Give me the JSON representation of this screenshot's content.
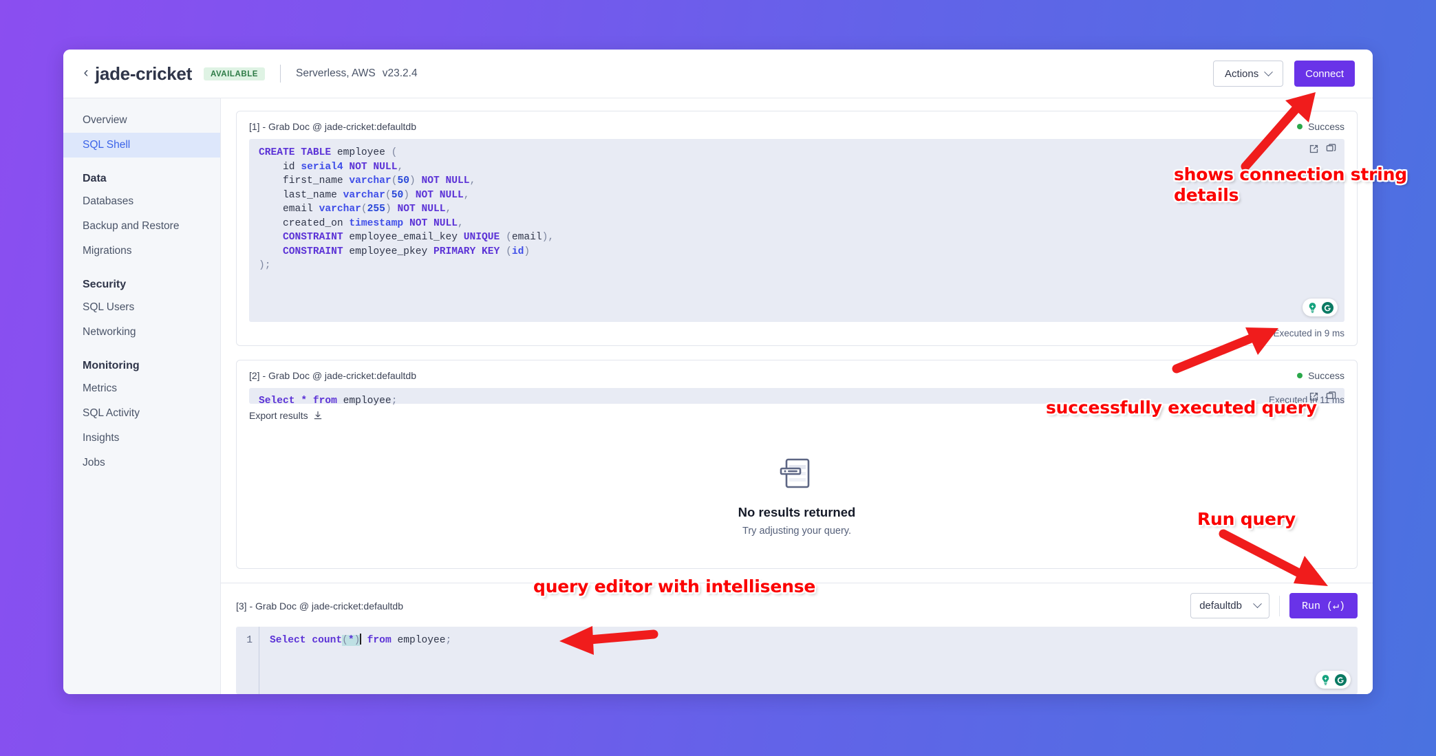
{
  "header": {
    "back_icon": "chevron-left-icon",
    "cluster_name": "jade-cricket",
    "status_badge": "AVAILABLE",
    "deployment": "Serverless, AWS",
    "version": "v23.2.4",
    "actions_label": "Actions",
    "connect_label": "Connect",
    "connect_color": "#6933e8"
  },
  "sidebar": {
    "items": [
      {
        "label": "Overview",
        "type": "item",
        "active": false
      },
      {
        "label": "SQL Shell",
        "type": "item",
        "active": true
      },
      {
        "label": "Data",
        "type": "group"
      },
      {
        "label": "Databases",
        "type": "item",
        "active": false
      },
      {
        "label": "Backup and Restore",
        "type": "item",
        "active": false
      },
      {
        "label": "Migrations",
        "type": "item",
        "active": false
      },
      {
        "label": "Security",
        "type": "group"
      },
      {
        "label": "SQL Users",
        "type": "item",
        "active": false
      },
      {
        "label": "Networking",
        "type": "item",
        "active": false
      },
      {
        "label": "Monitoring",
        "type": "group"
      },
      {
        "label": "Metrics",
        "type": "item",
        "active": false
      },
      {
        "label": "SQL Activity",
        "type": "item",
        "active": false
      },
      {
        "label": "Insights",
        "type": "item",
        "active": false
      },
      {
        "label": "Jobs",
        "type": "item",
        "active": false
      }
    ]
  },
  "statements": [
    {
      "index": "[1]",
      "separator": "-",
      "context": "Grab Doc @ jade-cricket:defaultdb",
      "status": "Success",
      "status_color": "#2aa84a",
      "executed": "Executed in 9 ms",
      "sql_plain": "CREATE TABLE employee (\n    id serial4 NOT NULL,\n    first_name varchar(50) NOT NULL,\n    last_name varchar(50) NOT NULL,\n    email varchar(255) NOT NULL,\n    created_on timestamp NOT NULL,\n    CONSTRAINT employee_email_key UNIQUE (email),\n    CONSTRAINT employee_pkey PRIMARY KEY (id)\n);"
    },
    {
      "index": "[2]",
      "separator": "-",
      "context": "Grab Doc @ jade-cricket:defaultdb",
      "status": "Success",
      "status_color": "#2aa84a",
      "executed": "Executed in 11 ms",
      "sql_plain": "Select * from employee;",
      "export_label": "Export results",
      "empty_title": "No results returned",
      "empty_sub": "Try adjusting your query."
    }
  ],
  "editor": {
    "index": "[3]",
    "separator": "-",
    "context": "Grab Doc @ jade-cricket:defaultdb",
    "database_value": "defaultdb",
    "run_label": "Run  (↵)",
    "line_number": "1",
    "code_plain": "Select count(*) from employee;"
  },
  "annotations": [
    {
      "name": "connect-annotation",
      "lines": [
        "shows connection string",
        "details"
      ]
    },
    {
      "name": "query-success-annotation",
      "lines": [
        "successfully executed query"
      ]
    },
    {
      "name": "run-query-annotation",
      "lines": [
        "Run query"
      ]
    },
    {
      "name": "editor-annotation",
      "lines": [
        "query editor with intellisense"
      ]
    }
  ]
}
